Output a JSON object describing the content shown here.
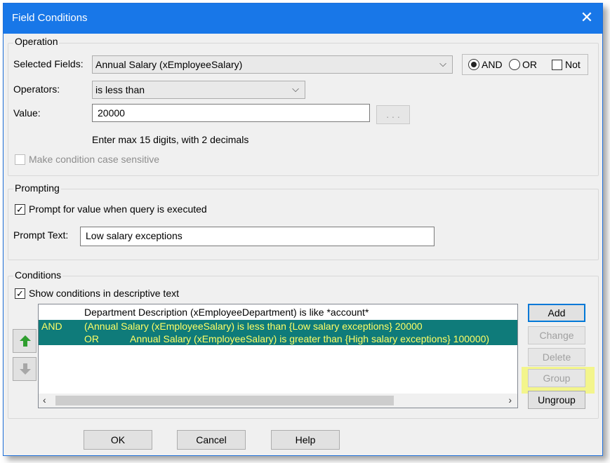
{
  "window": {
    "title": "Field Conditions",
    "close_glyph": "✕"
  },
  "operation": {
    "legend": "Operation",
    "selected_fields_label": "Selected Fields:",
    "selected_field_value": "Annual Salary (xEmployeeSalary)",
    "logic": {
      "and_label": "AND",
      "or_label": "OR",
      "not_label": "Not",
      "and_selected": true,
      "or_selected": false,
      "not_checked": false
    },
    "operators_label": "Operators:",
    "operator_value": "is less than",
    "value_label": "Value:",
    "value": "20000",
    "ellipsis_label": ". . .",
    "hint": "Enter max 15 digits, with 2 decimals",
    "case_sensitive_label": "Make condition case sensitive"
  },
  "prompting": {
    "legend": "Prompting",
    "prompt_checkbox_label": "Prompt for value when query is executed",
    "prompt_checked": true,
    "prompt_text_label": "Prompt Text:",
    "prompt_text_value": "Low salary exceptions"
  },
  "conditions": {
    "legend": "Conditions",
    "show_descriptive_label": "Show conditions in descriptive text",
    "show_descriptive_checked": true,
    "rows": [
      {
        "conj": "",
        "text": "Department Description (xEmployeeDepartment) is like *account*",
        "selected": false
      },
      {
        "conj": "AND",
        "text": "(Annual Salary (xEmployeeSalary) is less than {Low salary exceptions} 20000",
        "selected": true
      },
      {
        "conj": "OR",
        "text": "Annual Salary (xEmployeeSalary) is greater than {High salary exceptions} 100000)",
        "selected": true
      }
    ],
    "buttons": {
      "add": "Add",
      "change": "Change",
      "delete": "Delete",
      "group": "Group",
      "ungroup": "Ungroup"
    }
  },
  "footer": {
    "ok": "OK",
    "cancel": "Cancel",
    "help": "Help"
  },
  "colors": {
    "title_bar": "#1877e8",
    "selection_bg": "#0f7b7a",
    "selection_fg": "#ffff66",
    "group_highlight": "#f3f58c",
    "up_arrow": "#2e9d2e"
  }
}
